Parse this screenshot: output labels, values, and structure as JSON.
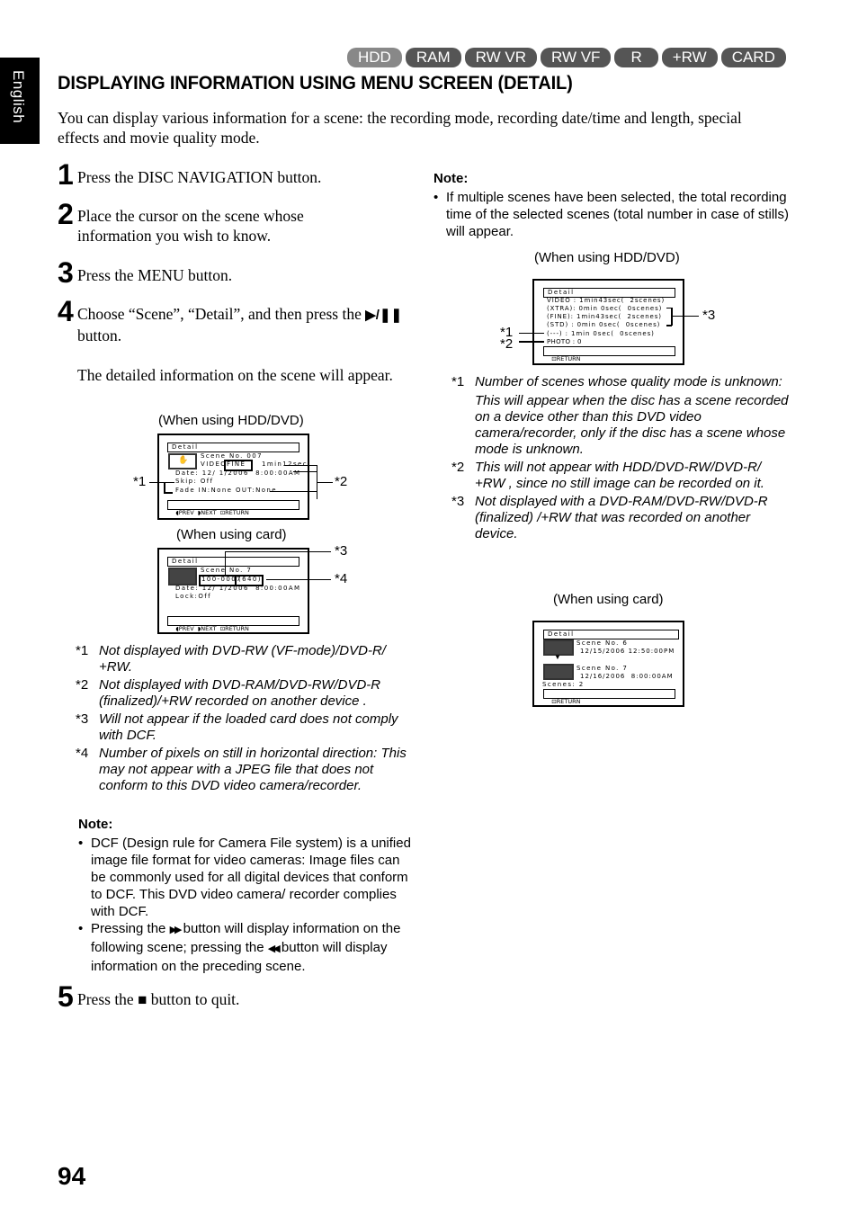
{
  "side_tab": {
    "label": "English"
  },
  "media_tabs": [
    {
      "label": "HDD",
      "active": true
    },
    {
      "label": "RAM",
      "active": false
    },
    {
      "label": "RW VR",
      "active": false
    },
    {
      "label": "RW VF",
      "active": false
    },
    {
      "label": "R",
      "active": false
    },
    {
      "label": "+RW",
      "active": false
    },
    {
      "label": "CARD",
      "active": false
    }
  ],
  "title": "DISPLAYING INFORMATION USING MENU SCREEN (DETAIL)",
  "intro": "You can display various information for a scene: the recording mode, recording date/time and length, special effects and movie quality mode.",
  "steps": [
    {
      "num": "1",
      "text": "Press the DISC NAVIGATION button."
    },
    {
      "num": "2",
      "text": "Place the cursor on the scene whose information you wish to know."
    },
    {
      "num": "3",
      "text": "Press the MENU button."
    },
    {
      "num": "4",
      "text_before": "Choose “Scene”, “Detail”, and then press the",
      "icon": "play-pause-icon",
      "icon_glyph": "▶/❚❚",
      "text_after": "button.",
      "result": "The detailed information on the scene will appear."
    },
    {
      "num": "5",
      "text_before": "Press the",
      "icon": "stop-icon",
      "icon_glyph": "■",
      "text_after": "button to quit."
    }
  ],
  "screen_hdd": {
    "caption": "(When using HDD/DVD)",
    "title": "Detail",
    "scene": "Scene No. 007",
    "video_label": "VIDEO",
    "quality": "FINE",
    "length": "1min12sec",
    "date": "Date: 12/ 1/2006  8:00:00AM",
    "skip": "Skip: Off",
    "fade": "Fade IN:None OUT:None",
    "nav": {
      "prev": "PREV",
      "next": "NEXT",
      "return": "RETURN"
    },
    "callouts": [
      "*1",
      "*2"
    ]
  },
  "screen_card": {
    "caption": "(When using card)",
    "title": "Detail",
    "scene": "Scene No. 7",
    "file": "100-0007",
    "pixels": "(640)",
    "date": "Date: 12/ 1/2006  8:00:00AM",
    "lock": "Lock:Off",
    "nav": {
      "prev": "PREV",
      "next": "NEXT",
      "return": "RETURN"
    },
    "callouts": [
      "*3",
      "*4"
    ]
  },
  "footnotes_left": [
    {
      "mark": "*1",
      "text": "Not displayed with DVD-RW (VF-mode)/DVD-R/ +RW."
    },
    {
      "mark": "*2",
      "text": "Not displayed with DVD-RAM/DVD-RW/DVD-R (finalized)/+RW recorded on another device ."
    },
    {
      "mark": "*3",
      "text": "Will not appear if the loaded card does not comply with DCF."
    },
    {
      "mark": "*4",
      "text": "Number of pixels on still in horizontal direction: This may not appear with a JPEG file that does not conform to this DVD video camera/recorder."
    }
  ],
  "note_left": {
    "heading": "Note:",
    "bullets": [
      {
        "text": "DCF (Design rule for Camera File system) is a unified image file format for video cameras: Image files can be commonly used for all digital devices that conform to DCF. This DVD video camera/ recorder complies with DCF."
      },
      {
        "text_before": "Pressing the",
        "icon1": "fast-forward-icon",
        "glyph1": "▶▶",
        "text_mid": "button will display information on the following scene; pressing the",
        "icon2": "rewind-icon",
        "glyph2": "◀◀",
        "text_after": "button will display information on the preceding scene."
      }
    ]
  },
  "note_right": {
    "heading": "Note:",
    "bullets": [
      {
        "text": "If multiple scenes have been selected, the total recording time of the selected scenes (total number in case of stills) will appear."
      }
    ]
  },
  "screen_multi": {
    "caption": "(When using HDD/DVD)",
    "title": "Detail",
    "rows": [
      "VIDEO : 1min43sec(  2scenes)",
      "(XTRA): 0min 0sec(  0scenes)",
      "(FINE): 1min43sec(  2scenes)",
      "(STD) : 0min 0sec(  0scenes)",
      "(---) : 1min 0sec(  0scenes)",
      "PHOTO : 0"
    ],
    "nav": {
      "return": "RETURN"
    },
    "callouts": [
      "*1",
      "*2",
      "*3"
    ]
  },
  "footnotes_right": [
    {
      "mark": "*1",
      "text": "Number of scenes whose quality mode is unknown:",
      "extra": "This will appear when the disc has a scene recorded on a device other than this DVD video camera/recorder, only if the disc has a scene whose mode is unknown."
    },
    {
      "mark": "*2",
      "text": "This will not appear with HDD/DVD-RW/DVD-R/ +RW , since no still image can be recorded on it."
    },
    {
      "mark": "*3",
      "text": "Not displayed with a DVD-RAM/DVD-RW/DVD-R (finalized) /+RW that was recorded on another device."
    }
  ],
  "screen_card_multi": {
    "caption": "(When using card)",
    "title": "Detail",
    "scene1": "Scene No. 6",
    "date1": "12/15/2006 12:50:00PM",
    "scene2": "Scene No. 7",
    "date2": "12/16/2006  8:00:00AM",
    "scenes": "Scenes: 2",
    "nav": {
      "return": "RETURN"
    }
  },
  "page_number": "94"
}
